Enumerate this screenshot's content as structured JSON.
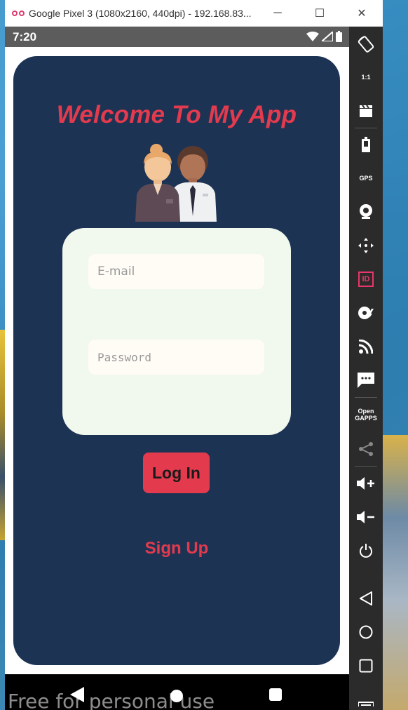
{
  "window": {
    "title": "Google Pixel 3 (1080x2160, 440dpi) - 192.168.83...",
    "controls": [
      "─",
      "☐",
      "✕"
    ]
  },
  "status_bar": {
    "time": "7:20"
  },
  "app": {
    "welcome_title": "Welcome To My App",
    "email_placeholder": "E-mail",
    "password_placeholder": "Password",
    "login_label": "Log In",
    "signup_label": "Sign Up"
  },
  "side_toolbar": {
    "items": [
      {
        "icon": "rotate-icon"
      },
      {
        "icon": "fullscreen-icon",
        "label": "1:1"
      },
      {
        "icon": "clapperboard-icon"
      },
      {
        "icon": "battery-icon"
      },
      {
        "icon": "gps-icon",
        "label": "GPS"
      },
      {
        "icon": "camera-icon"
      },
      {
        "icon": "move-icon"
      },
      {
        "icon": "id-icon",
        "label": "ID"
      },
      {
        "icon": "disk-icon"
      },
      {
        "icon": "rss-icon"
      },
      {
        "icon": "sms-icon"
      },
      {
        "icon": "opengapps-icon",
        "label": "Open\nGAPPS"
      },
      {
        "icon": "share-icon"
      },
      {
        "icon": "volume-up-icon"
      },
      {
        "icon": "volume-down-icon"
      },
      {
        "icon": "power-icon"
      },
      {
        "icon": "back-icon"
      },
      {
        "icon": "home-icon"
      },
      {
        "icon": "recent-icon"
      }
    ]
  },
  "watermark": "Free for personal use",
  "colors": {
    "card_bg": "#1d3354",
    "accent": "#e43a4e",
    "form_bg": "#f1f8ee",
    "field_bg": "#fffcf6"
  }
}
